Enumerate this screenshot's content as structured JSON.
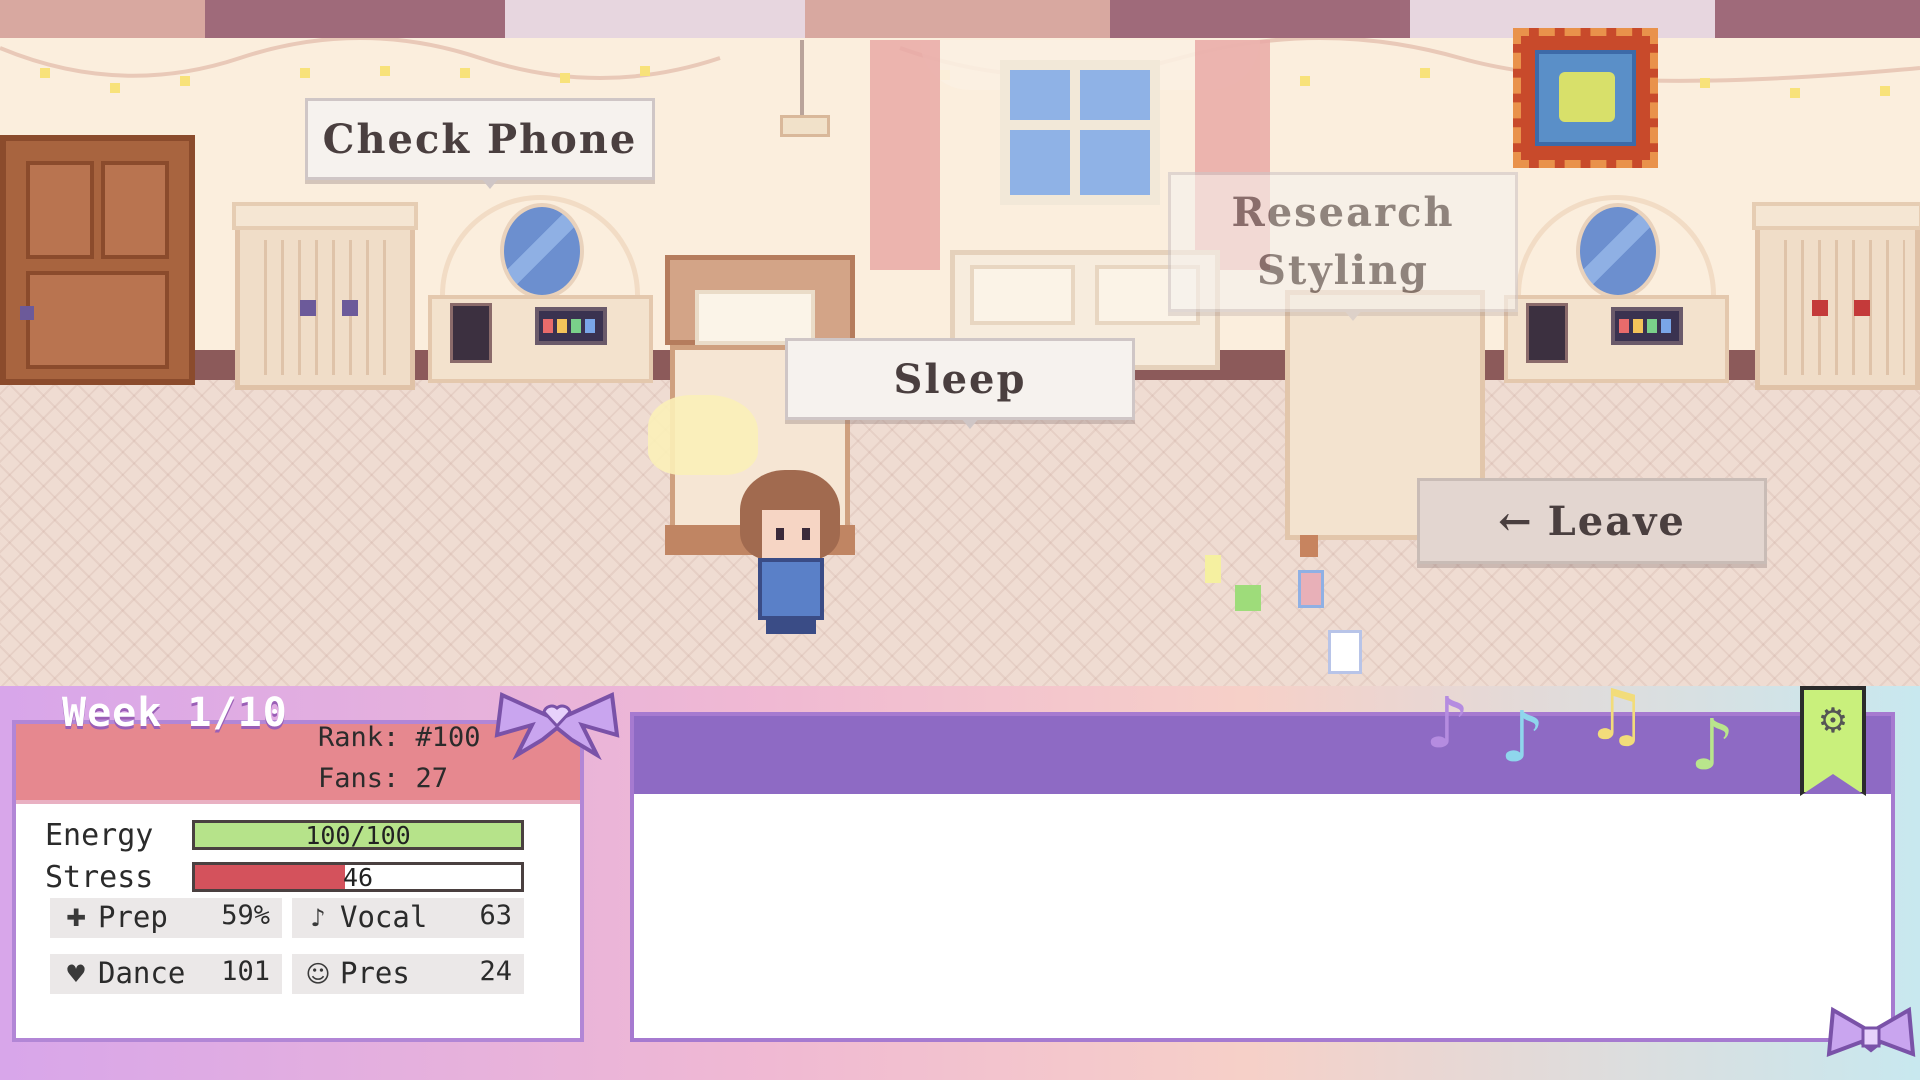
{
  "actions": {
    "check_phone": "Check Phone",
    "sleep": "Sleep",
    "research_line1": "Research",
    "research_line2": "Styling",
    "leave_arrow": "←",
    "leave": "Leave"
  },
  "hud": {
    "week": "Week 1/10",
    "rank": "Rank: #100",
    "fans": "Fans: 27",
    "energy": {
      "label": "Energy",
      "text": "100/100",
      "value": 100,
      "max": 100,
      "color": "#b6e38a"
    },
    "stress": {
      "label": "Stress",
      "text": "46",
      "value": 46,
      "max": 100,
      "color": "#d4525c"
    },
    "skills": [
      {
        "icon": "✚",
        "name": "Prep",
        "value": "59%"
      },
      {
        "icon": "♪",
        "name": "Vocal",
        "value": "63"
      },
      {
        "icon": "♥",
        "name": "Dance",
        "value": "101"
      },
      {
        "icon": "☺",
        "name": "Pres",
        "value": "24"
      }
    ],
    "notes": [
      "♪",
      "♪",
      "♫",
      "♪"
    ],
    "note_colors": [
      "#b58ce0",
      "#8fd6ec",
      "#f2dc7a",
      "#b9e58c"
    ],
    "settings_icon": "⚙"
  }
}
